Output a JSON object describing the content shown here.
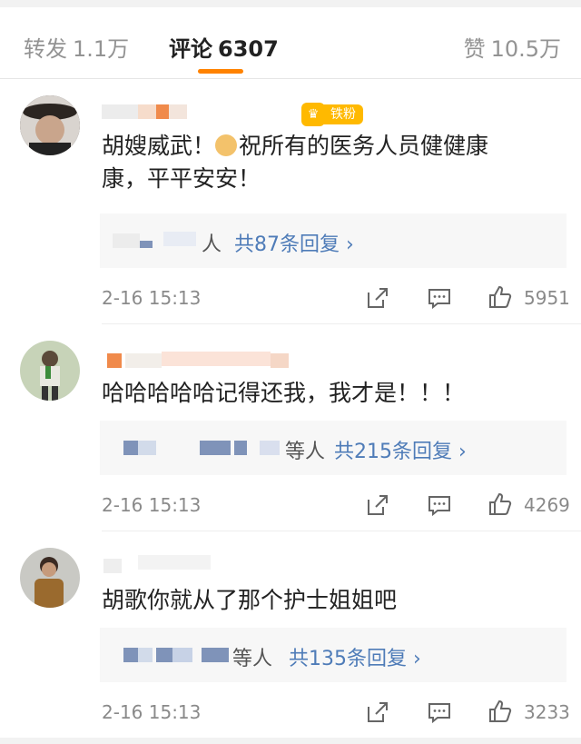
{
  "tabs": {
    "repost_label": "转发",
    "repost_count": "1.1万",
    "comment_label": "评论",
    "comment_count": "6307",
    "like_label": "赞",
    "like_count": "10.5万"
  },
  "comments": [
    {
      "fan_badge": "铁粉",
      "text_line1_a": "胡嫂威武！",
      "text_line1_b": "祝所有的医务人员健健康",
      "text_line2": "康，平平安安！",
      "reply_suffix": "人",
      "reply_count": "共87条回复 ›",
      "time": "2-16 15:13",
      "likes": "5951"
    },
    {
      "text_line1": "哈哈哈哈哈记得还我，我才是！！！",
      "reply_suffix": "等人",
      "reply_count": "共215条回复 ›",
      "time": "2-16 15:13",
      "likes": "4269"
    },
    {
      "text_line1": "胡歌你就从了那个护士姐姐吧",
      "reply_suffix": "等人",
      "reply_count": "共135条回复 ›",
      "time": "2-16 15:13",
      "likes": "3233"
    }
  ],
  "colors": {
    "accent": "#ff8200",
    "link": "#4f7cb8",
    "badge": "#ffb900"
  },
  "icons": [
    "share-icon",
    "comment-icon",
    "thumbs-up-icon",
    "crown-icon",
    "doge-emoji"
  ]
}
